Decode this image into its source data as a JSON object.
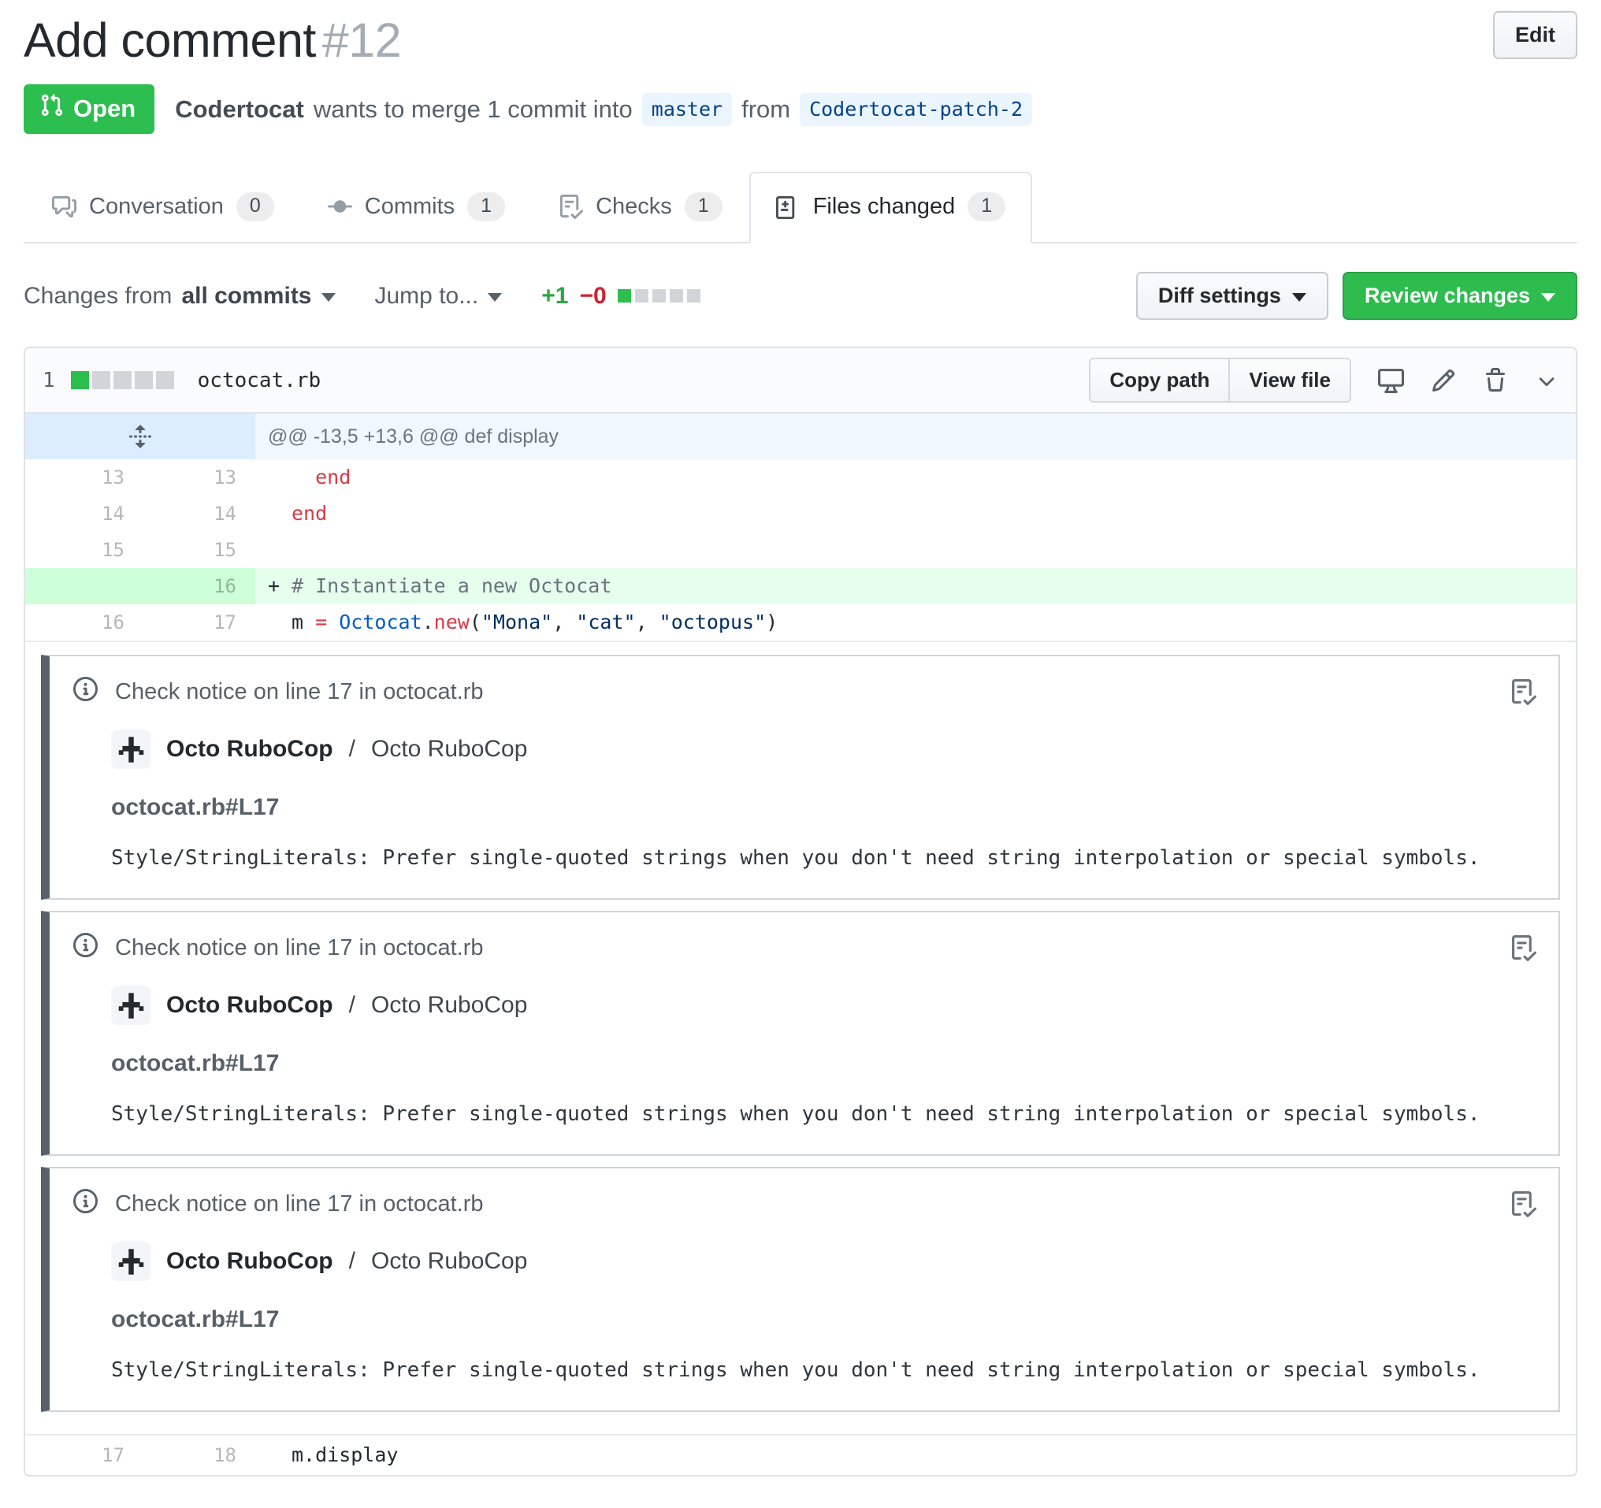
{
  "header": {
    "title": "Add comment",
    "number": "#12",
    "edit_label": "Edit"
  },
  "status": {
    "state_label": "Open",
    "author": "Codertocat",
    "description": "wants to merge 1 commit into",
    "base_branch": "master",
    "from_word": "from",
    "head_branch": "Codertocat-patch-2"
  },
  "tabs": [
    {
      "label": "Conversation",
      "count": "0",
      "icon": "comment-discussion-icon",
      "active": false
    },
    {
      "label": "Commits",
      "count": "1",
      "icon": "git-commit-icon",
      "active": false
    },
    {
      "label": "Checks",
      "count": "1",
      "icon": "checklist-icon",
      "active": false
    },
    {
      "label": "Files changed",
      "count": "1",
      "icon": "file-diff-icon",
      "active": true
    }
  ],
  "toolbar": {
    "changes_from_label": "Changes from",
    "changes_from_value": "all commits",
    "jump_to_label": "Jump to...",
    "additions": "+1",
    "deletions": "−0",
    "diffstat_blocks": [
      "added",
      "neutral",
      "neutral",
      "neutral",
      "neutral"
    ],
    "diff_settings_label": "Diff settings",
    "review_changes_label": "Review changes"
  },
  "file": {
    "files_count": "1",
    "diffstat_blocks": [
      "added",
      "neutral",
      "neutral",
      "neutral",
      "neutral"
    ],
    "name": "octocat.rb",
    "copy_path_label": "Copy path",
    "view_file_label": "View file"
  },
  "diff": {
    "hunk_header": "@@ -13,5 +13,6 @@ def display",
    "rows": [
      {
        "type": "ctx",
        "old": "13",
        "new": "13",
        "sign": " ",
        "tokens": [
          {
            "t": "  end",
            "c": "k"
          }
        ]
      },
      {
        "type": "ctx",
        "old": "14",
        "new": "14",
        "sign": " ",
        "tokens": [
          {
            "t": "end",
            "c": "k"
          }
        ]
      },
      {
        "type": "ctx",
        "old": "15",
        "new": "15",
        "sign": " ",
        "tokens": []
      },
      {
        "type": "add",
        "old": "",
        "new": "16",
        "sign": "+",
        "tokens": [
          {
            "t": "# Instantiate a new Octocat",
            "c": "cm"
          }
        ]
      },
      {
        "type": "ctx",
        "old": "16",
        "new": "17",
        "sign": " ",
        "tokens": [
          {
            "t": "m ",
            "c": "p"
          },
          {
            "t": "=",
            "c": "k"
          },
          {
            "t": " ",
            "c": "p"
          },
          {
            "t": "Octocat",
            "c": "c"
          },
          {
            "t": ".",
            "c": "p"
          },
          {
            "t": "new",
            "c": "k"
          },
          {
            "t": "(",
            "c": "p"
          },
          {
            "t": "\"Mona\"",
            "c": "s"
          },
          {
            "t": ", ",
            "c": "p"
          },
          {
            "t": "\"cat\"",
            "c": "s"
          },
          {
            "t": ", ",
            "c": "p"
          },
          {
            "t": "\"octopus\"",
            "c": "s"
          },
          {
            "t": ")",
            "c": "p"
          }
        ]
      }
    ],
    "tail_rows": [
      {
        "type": "ctx",
        "old": "17",
        "new": "18",
        "sign": " ",
        "tokens": [
          {
            "t": "m.display",
            "c": "p"
          }
        ]
      }
    ]
  },
  "notices": [
    {
      "header": "Check notice on line 17 in octocat.rb",
      "app_name": "Octo RuboCop",
      "separator": "/",
      "app_context": "Octo RuboCop",
      "path": "octocat.rb#L17",
      "message": "Style/StringLiterals: Prefer single-quoted strings when you don't need string interpolation or special symbols."
    },
    {
      "header": "Check notice on line 17 in octocat.rb",
      "app_name": "Octo RuboCop",
      "separator": "/",
      "app_context": "Octo RuboCop",
      "path": "octocat.rb#L17",
      "message": "Style/StringLiterals: Prefer single-quoted strings when you don't need string interpolation or special symbols."
    },
    {
      "header": "Check notice on line 17 in octocat.rb",
      "app_name": "Octo RuboCop",
      "separator": "/",
      "app_context": "Octo RuboCop",
      "path": "octocat.rb#L17",
      "message": "Style/StringLiterals: Prefer single-quoted strings when you don't need string interpolation or special symbols."
    }
  ],
  "icons": {
    "state_badge": "git-pull-request-icon",
    "file_header_actions": [
      "device-desktop-icon",
      "pencil-icon",
      "trash-icon",
      "chevron-down-icon"
    ],
    "hunk_gutter": "unfold-icon",
    "notice_left": "info-icon",
    "notice_right": "checklist-icon",
    "app_avatar": "octo-rubocop-avatar"
  },
  "colors": {
    "open_green": "#2cbe4e",
    "button_green": "#2ebc4f",
    "addition_green": "#28a745",
    "deletion_red": "#cb2431",
    "added_row_bg": "#e6ffed",
    "added_gutter_bg": "#cdffd8",
    "hunk_bg": "#f1f8ff",
    "hunk_gutter_bg": "#dbedff",
    "keyword_red": "#d73a49",
    "constant_blue": "#005cc5",
    "string_navy": "#032f62",
    "comment_gray": "#6a737d",
    "branch_label_bg": "#eaf5ff",
    "branch_label_fg": "#044289",
    "notice_bar": "#586069",
    "border": "#e1e4e8"
  }
}
